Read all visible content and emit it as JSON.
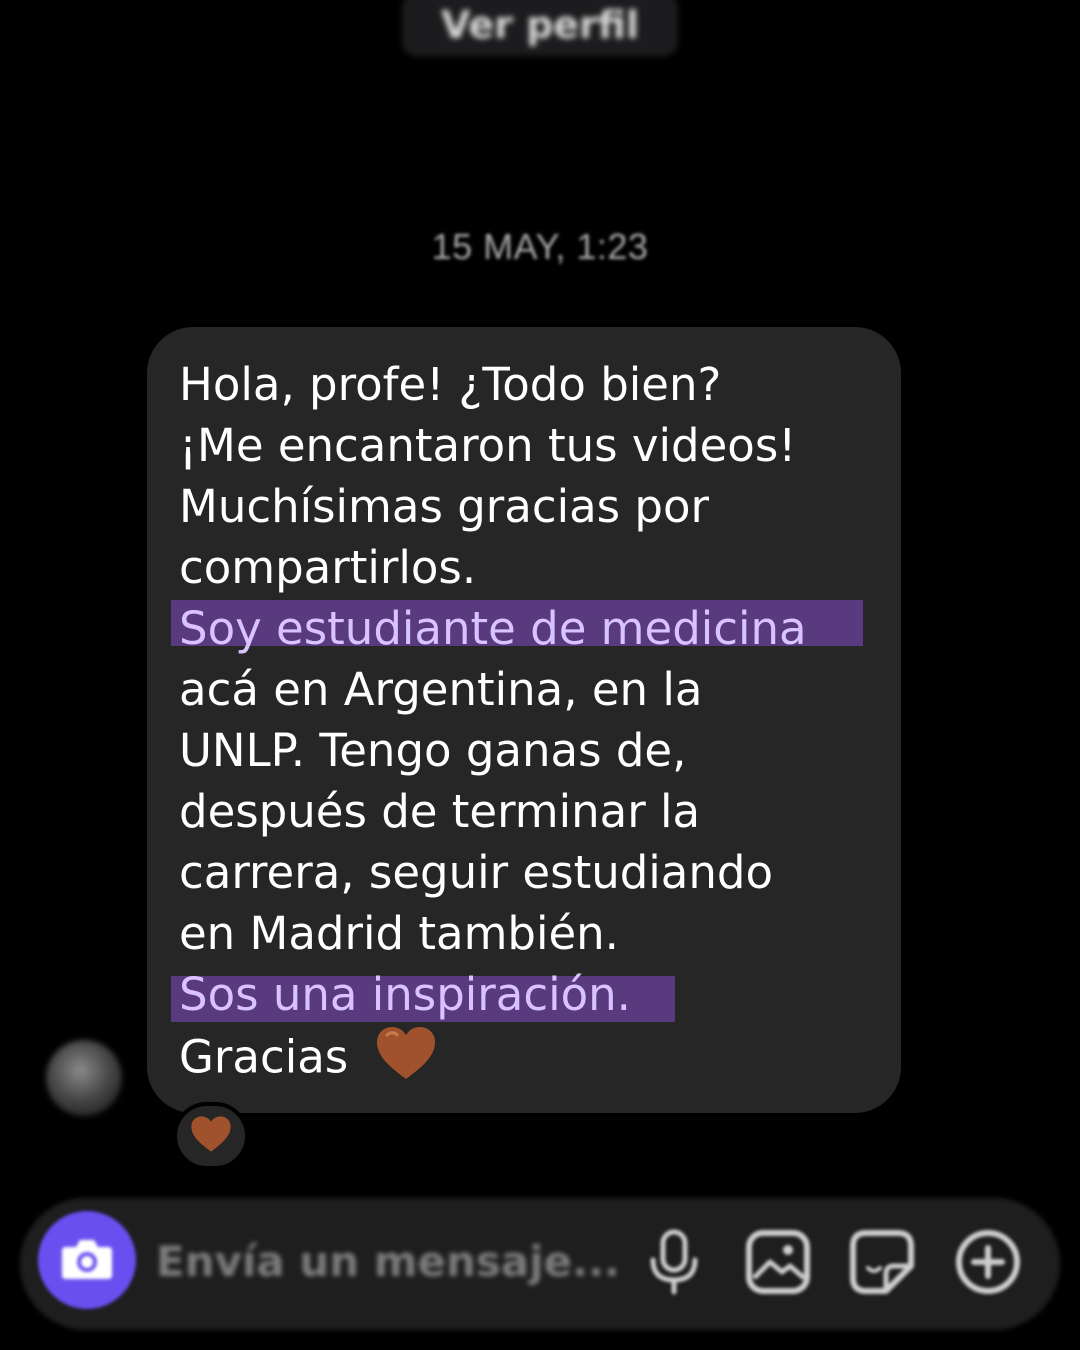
{
  "header": {
    "profile_button": "Ver perfil"
  },
  "thread": {
    "timestamp": "15 MAY, 1:23"
  },
  "message": {
    "lines": [
      "Hola, profe! ¿Todo bien?",
      "¡Me encantaron tus videos!",
      "Muchísimas gracias por",
      "compartirlos.",
      "Soy estudiante de medicina",
      "acá en Argentina, en la",
      "UNLP. Tengo ganas de,",
      "después de terminar la",
      "carrera, seguir estudiando",
      "en Madrid también.",
      "Sos una inspiración.",
      "Gracias"
    ],
    "emoji": "brown-heart",
    "highlight_color": "#5a3a7e",
    "bubble_color": "#262626",
    "reaction": "brown-heart"
  },
  "composer": {
    "placeholder": "Envía un mensaje...",
    "accent_color": "#6a4ff0",
    "icons": [
      "camera-icon",
      "microphone-icon",
      "gallery-icon",
      "sticker-icon",
      "add-icon"
    ]
  }
}
